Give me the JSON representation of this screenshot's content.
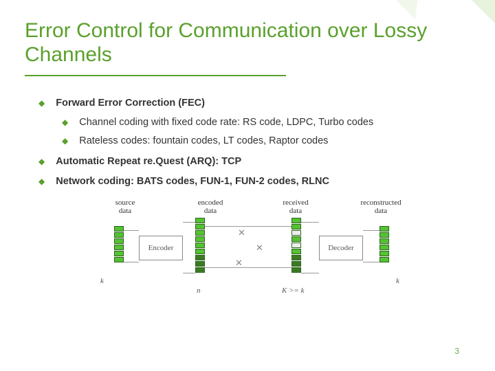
{
  "title": "Error Control for Communication over Lossy Channels",
  "bullets": {
    "b1": "Forward Error Correction (FEC)",
    "b1a": "Channel coding with fixed code rate: RS code, LDPC, Turbo codes",
    "b1b": "Rateless codes: fountain codes, LT codes, Raptor codes",
    "b2": "Automatic Repeat re.Quest (ARQ): TCP",
    "b3": "Network coding: BATS codes, FUN-1, FUN-2 codes, RLNC"
  },
  "figure": {
    "col1": "source\ndata",
    "col2": "encoded\ndata",
    "col3": "received\ndata",
    "col4": "reconstructed\ndata",
    "encoder": "Encoder",
    "decoder": "Decoder",
    "k1": "k",
    "n": "n",
    "kge": "K >= k",
    "k2": "k"
  },
  "page_number": "3"
}
